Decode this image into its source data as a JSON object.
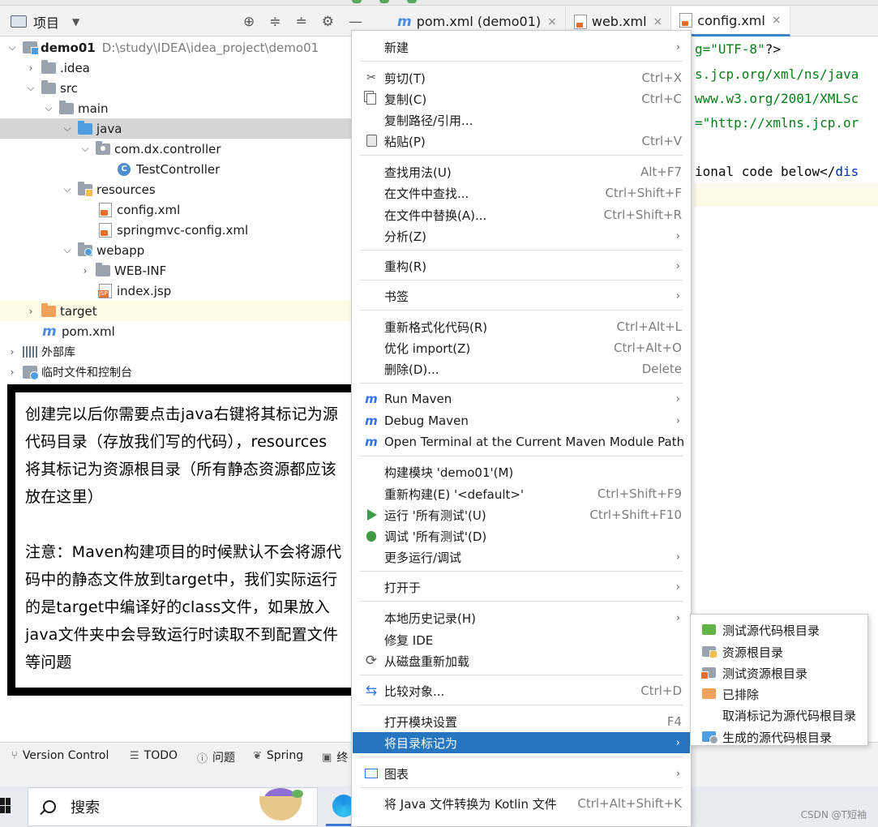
{
  "header": {
    "project_title": "项目",
    "tabs": [
      {
        "label": "pom.xml (demo01)",
        "icon": "maven-icon"
      },
      {
        "label": "web.xml",
        "icon": "xml-file-icon"
      },
      {
        "label": "config.xml",
        "icon": "xml-file-icon"
      }
    ]
  },
  "tree": {
    "root_name": "demo01",
    "root_path": "D:\\study\\IDEA\\idea_project\\demo01",
    "items": [
      {
        "label": ".idea"
      },
      {
        "label": "src"
      },
      {
        "label": "main"
      },
      {
        "label": "java"
      },
      {
        "label": "com.dx.controller"
      },
      {
        "label": "TestController"
      },
      {
        "label": "resources"
      },
      {
        "label": "config.xml"
      },
      {
        "label": "springmvc-config.xml"
      },
      {
        "label": "webapp"
      },
      {
        "label": "WEB-INF"
      },
      {
        "label": "index.jsp"
      },
      {
        "label": "target"
      },
      {
        "label": "pom.xml"
      },
      {
        "label": "外部库"
      },
      {
        "label": "临时文件和控制台"
      }
    ]
  },
  "note": {
    "para1": "创建完以后你需要点击java右键将其标记为源代码目录（存放我们写的代码），resources将其标记为资源根目录（所有静态资源都应该放在这里）",
    "para2": "注意：Maven构建项目的时候默认不会将源代码中的静态文件放到target中，我们实际运行的是target中编译好的class文件，如果放入java文件夹中会导致运行时读取不到配置文件等问题"
  },
  "editor": {
    "lines": [
      {
        "str": "g=\"UTF-8\"",
        "tail": "?>"
      },
      {
        "str": "s.jcp.org/xml/ns/java"
      },
      {
        "str": "www.w3.org/2001/XMLSc"
      },
      {
        "str": "=\"http://xmlns.jcp.or"
      },
      {
        "pre": "ional code below</",
        "tag": "dis"
      }
    ]
  },
  "context_menu": {
    "items": [
      {
        "label": "新建",
        "shortcut": "",
        "submenu": true
      },
      {
        "label": "剪切(T)",
        "shortcut": "Ctrl+X",
        "icon": "cut-icon"
      },
      {
        "label": "复制(C)",
        "shortcut": "Ctrl+C",
        "icon": "copy-icon"
      },
      {
        "label": "复制路径/引用...",
        "shortcut": ""
      },
      {
        "label": "粘贴(P)",
        "shortcut": "Ctrl+V",
        "icon": "paste-icon"
      },
      {
        "label": "查找用法(U)",
        "shortcut": "Alt+F7"
      },
      {
        "label": "在文件中查找...",
        "shortcut": "Ctrl+Shift+F"
      },
      {
        "label": "在文件中替换(A)...",
        "shortcut": "Ctrl+Shift+R"
      },
      {
        "label": "分析(Z)",
        "shortcut": "",
        "submenu": true
      },
      {
        "label": "重构(R)",
        "shortcut": "",
        "submenu": true
      },
      {
        "label": "书签",
        "shortcut": "",
        "submenu": true
      },
      {
        "label": "重新格式化代码(R)",
        "shortcut": "Ctrl+Alt+L"
      },
      {
        "label": "优化 import(Z)",
        "shortcut": "Ctrl+Alt+O"
      },
      {
        "label": "删除(D)...",
        "shortcut": "Delete"
      },
      {
        "label": "Run Maven",
        "shortcut": "",
        "submenu": true,
        "icon": "maven-run-icon"
      },
      {
        "label": "Debug Maven",
        "shortcut": "",
        "submenu": true,
        "icon": "maven-debug-icon"
      },
      {
        "label": "Open Terminal at the Current Maven Module Path",
        "shortcut": "",
        "icon": "maven-terminal-icon"
      },
      {
        "label": "构建模块 'demo01'(M)",
        "shortcut": ""
      },
      {
        "label": "重新构建(E) '<default>'",
        "shortcut": "Ctrl+Shift+F9"
      },
      {
        "label": "运行 '所有测试'(U)",
        "shortcut": "Ctrl+Shift+F10",
        "icon": "run-icon"
      },
      {
        "label": "调试 '所有测试'(D)",
        "shortcut": "",
        "icon": "debug-icon"
      },
      {
        "label": "更多运行/调试",
        "shortcut": "",
        "submenu": true
      },
      {
        "label": "打开于",
        "shortcut": "",
        "submenu": true
      },
      {
        "label": "本地历史记录(H)",
        "shortcut": "",
        "submenu": true
      },
      {
        "label": "修复 IDE",
        "shortcut": ""
      },
      {
        "label": "从磁盘重新加载",
        "shortcut": "",
        "icon": "reload-icon"
      },
      {
        "label": "比较对象...",
        "shortcut": "Ctrl+D",
        "icon": "compare-icon"
      },
      {
        "label": "打开模块设置",
        "shortcut": "F4"
      },
      {
        "label": "将目录标记为",
        "shortcut": "",
        "submenu": true,
        "active": true
      },
      {
        "label": "图表",
        "shortcut": "",
        "submenu": true,
        "icon": "diagram-icon"
      },
      {
        "label": "将 Java 文件转换为 Kotlin 文件",
        "shortcut": "Ctrl+Alt+Shift+K"
      }
    ]
  },
  "submenu": {
    "items": [
      {
        "label": "测试源代码根目录",
        "icon": "test-sources-folder-icon"
      },
      {
        "label": "资源根目录",
        "icon": "resources-folder-icon"
      },
      {
        "label": "测试资源根目录",
        "icon": "test-resources-folder-icon"
      },
      {
        "label": "已排除",
        "icon": "excluded-folder-icon"
      },
      {
        "label": "取消标记为源代码根目录",
        "icon": ""
      },
      {
        "label": "生成的源代码根目录",
        "icon": "generated-sources-folder-icon"
      }
    ]
  },
  "tool_windows": [
    {
      "label": "Version Control"
    },
    {
      "label": "TODO"
    },
    {
      "label": "问题"
    },
    {
      "label": "Spring"
    },
    {
      "label": "终"
    }
  ],
  "taskbar": {
    "search_text": "搜索"
  },
  "watermark": "CSDN @T短袖",
  "colors": {
    "accent": "#2675bf",
    "selection_row": "#d5d5d5",
    "source_folder": "#4d9de0",
    "excluded_folder": "#f0a15a",
    "test_folder": "#62b543"
  }
}
